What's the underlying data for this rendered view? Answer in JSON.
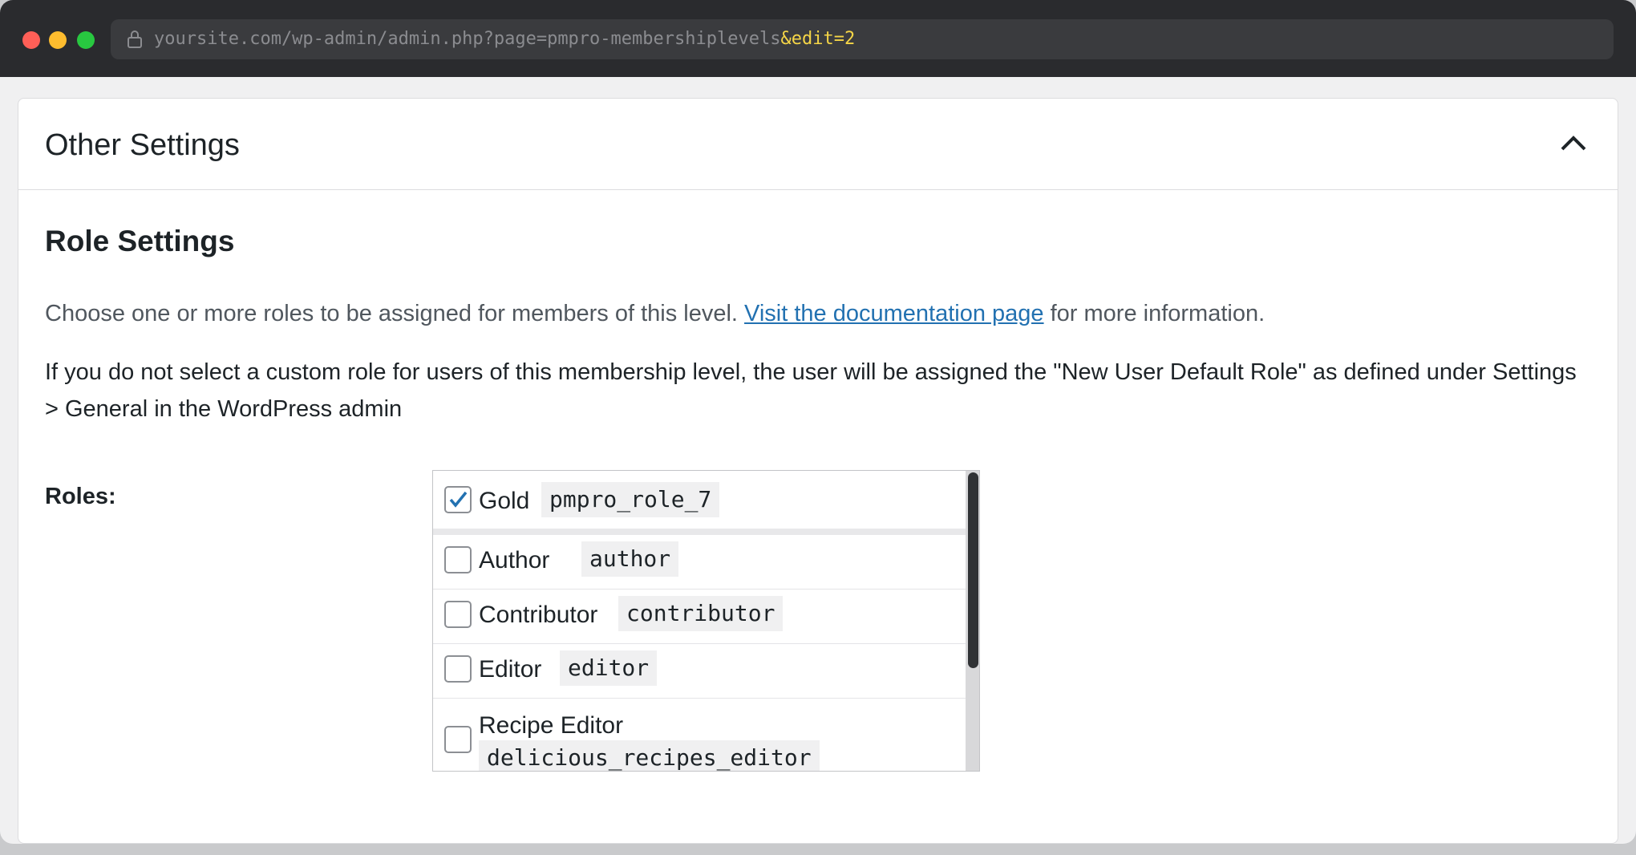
{
  "browser": {
    "url_main": "yoursite.com/wp-admin/admin.php?page=pmpro-membershiplevels",
    "url_highlight": "&edit=2"
  },
  "panel": {
    "title": "Other Settings"
  },
  "role_settings": {
    "title": "Role Settings",
    "desc_before": "Choose one or more roles to be assigned for members of this level. ",
    "desc_link": "Visit the documentation page",
    "desc_after": " for more information.",
    "note": "If you do not select a custom role for users of this membership level, the user will be assigned the \"New User Default Role\" as defined under Settings > General in the WordPress admin",
    "roles_label": "Roles:",
    "roles": [
      {
        "name": "Gold",
        "slug": "pmpro_role_7",
        "checked": true
      },
      {
        "name": "Author",
        "slug": "author",
        "checked": false
      },
      {
        "name": "Contributor",
        "slug": "contributor",
        "checked": false
      },
      {
        "name": "Editor",
        "slug": "editor",
        "checked": false
      },
      {
        "name": "Recipe Editor",
        "slug": "delicious_recipes_editor",
        "checked": false
      }
    ]
  },
  "colors": {
    "link": "#2271b1",
    "check": "#2271b1",
    "url_highlight": "#f5d547"
  }
}
